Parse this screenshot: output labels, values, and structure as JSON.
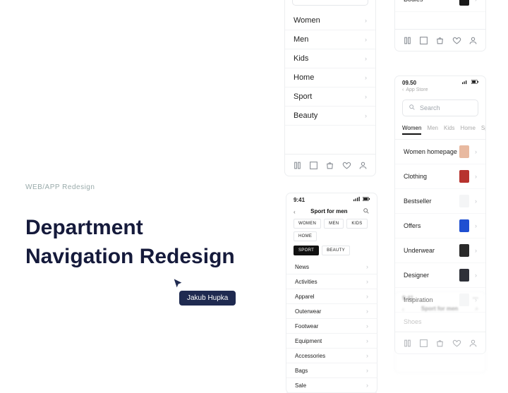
{
  "hero": {
    "tag": "WEB/APP Redesign",
    "title_line1": "Department",
    "title_line2": "Navigation Redesign",
    "author": "Jakub Hupka"
  },
  "search": {
    "placeholder": "Search"
  },
  "phone1": {
    "items": [
      "Women",
      "Men",
      "Kids",
      "Home",
      "Sport",
      "Beauty"
    ]
  },
  "phone2": {
    "last_item": "Bodies"
  },
  "phone3": {
    "time": "9:41",
    "title": "Sport for men",
    "pills_row1": [
      "WOMEN",
      "MEN",
      "KIDS",
      "HOME"
    ],
    "pills_row2": [
      "SPORT",
      "BEAUTY"
    ],
    "items": [
      "News",
      "Activities",
      "Apparel",
      "Outerwear",
      "Footwear",
      "Equipment",
      "Accessories",
      "Bags",
      "Sale"
    ]
  },
  "phone4": {
    "time": "09.50",
    "sub": "App Store",
    "chips": [
      "Women",
      "Men",
      "Kids",
      "Home",
      "Sport"
    ],
    "rows": [
      {
        "label": "Women homepage",
        "swatch": "#e8b9a0"
      },
      {
        "label": "Clothing",
        "swatch": "#b7332e"
      },
      {
        "label": "Bestseller",
        "swatch": "#f4f5f6"
      },
      {
        "label": "Offers",
        "swatch": "#1f4fd1"
      },
      {
        "label": "Underwear",
        "swatch": "#2a2a2a"
      },
      {
        "label": "Designer",
        "swatch": "#2e3038"
      },
      {
        "label": "Inspiration",
        "swatch": "#f1f2f3"
      }
    ],
    "extra_row": "Shoes"
  },
  "phone5": {
    "time": "9:41",
    "title": "Sport for men"
  }
}
